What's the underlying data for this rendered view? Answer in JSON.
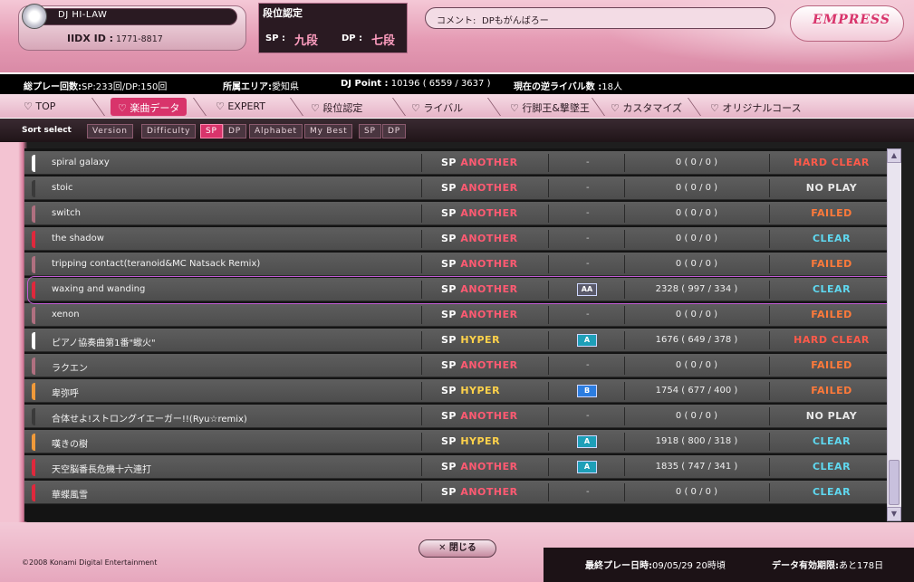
{
  "header": {
    "dj_name": "DJ HI-LAW",
    "iidx_id_label": "IIDX ID :",
    "iidx_id": "1771-8817",
    "dan_title": "段位認定",
    "sp_label": "SP :",
    "sp_dan": "九段",
    "dp_label": "DP :",
    "dp_dan": "七段",
    "comment_label": "コメント:",
    "comment_text": "DPもがんばろー",
    "logo_text": "EMPRESS"
  },
  "stats": {
    "plays_label": "総プレー回数:",
    "plays_value": "SP:233回/DP:150回",
    "area_label": "所属エリア:",
    "area_value": "愛知県",
    "djpoint_label": "DJ Point :",
    "djpoint_value": "10196 ( 6559 / 3637 )",
    "rival_label": "現在の逆ライバル数 :",
    "rival_value": "18人"
  },
  "nav": {
    "tabs": [
      {
        "label": "♡ TOP"
      },
      {
        "label": "♡ 楽曲データ"
      },
      {
        "label": "♡ EXPERT"
      },
      {
        "label": "♡ 段位認定"
      },
      {
        "label": "♡ ライバル"
      },
      {
        "label": "♡ 行脚王&撃墜王"
      },
      {
        "label": "♡ カスタマイズ"
      },
      {
        "label": "♡ オリジナルコース"
      }
    ]
  },
  "sort": {
    "label": "Sort select",
    "buttons": [
      "Version",
      "Difficulty",
      "SP",
      "DP",
      "Alphabet",
      "My Best",
      "SP",
      "DP"
    ]
  },
  "songs": [
    {
      "title": "spiral galaxy",
      "sp": "SP",
      "diff": "ANOTHER",
      "grade": "-",
      "score": "0 ( 0 / 0 )",
      "status": "HARD CLEAR",
      "accent": "#ffffff"
    },
    {
      "title": "stoic",
      "sp": "SP",
      "diff": "ANOTHER",
      "grade": "-",
      "score": "0 ( 0 / 0 )",
      "status": "NO PLAY",
      "accent": "#3a3a3a"
    },
    {
      "title": "switch",
      "sp": "SP",
      "diff": "ANOTHER",
      "grade": "-",
      "score": "0 ( 0 / 0 )",
      "status": "FAILED",
      "accent": "#b07080"
    },
    {
      "title": "the shadow",
      "sp": "SP",
      "diff": "ANOTHER",
      "grade": "-",
      "score": "0 ( 0 / 0 )",
      "status": "CLEAR",
      "accent": "#e0283c"
    },
    {
      "title": "tripping contact(teranoid&MC Natsack Remix)",
      "sp": "SP",
      "diff": "ANOTHER",
      "grade": "-",
      "score": "0 ( 0 / 0 )",
      "status": "FAILED",
      "accent": "#b07080"
    },
    {
      "title": "waxing and wanding",
      "sp": "SP",
      "diff": "ANOTHER",
      "grade": "AA",
      "score": "2328 ( 997 / 334 )",
      "status": "CLEAR",
      "accent": "#e0283c"
    },
    {
      "title": "xenon",
      "sp": "SP",
      "diff": "ANOTHER",
      "grade": "-",
      "score": "0 ( 0 / 0 )",
      "status": "FAILED",
      "accent": "#b07080"
    },
    {
      "title": "ピアノ協奏曲第1番\"蠍火\"",
      "sp": "SP",
      "diff": "HYPER",
      "grade": "A",
      "score": "1676 ( 649 / 378 )",
      "status": "HARD CLEAR",
      "accent": "#ffffff"
    },
    {
      "title": "ラクエン",
      "sp": "SP",
      "diff": "ANOTHER",
      "grade": "-",
      "score": "0 ( 0 / 0 )",
      "status": "FAILED",
      "accent": "#b07080"
    },
    {
      "title": "卑弥呼",
      "sp": "SP",
      "diff": "HYPER",
      "grade": "B",
      "score": "1754 ( 677 / 400 )",
      "status": "FAILED",
      "accent": "#f09a3a"
    },
    {
      "title": "合体せよ!ストロングイエーガー!!(Ryu☆remix)",
      "sp": "SP",
      "diff": "ANOTHER",
      "grade": "-",
      "score": "0 ( 0 / 0 )",
      "status": "NO PLAY",
      "accent": "#3a3a3a"
    },
    {
      "title": "嘆きの樹",
      "sp": "SP",
      "diff": "HYPER",
      "grade": "A",
      "score": "1918 ( 800 / 318 )",
      "status": "CLEAR",
      "accent": "#f09a3a"
    },
    {
      "title": "天空脳番長危機十六連打",
      "sp": "SP",
      "diff": "ANOTHER",
      "grade": "A",
      "score": "1835 ( 747 / 341 )",
      "status": "CLEAR",
      "accent": "#e0283c"
    },
    {
      "title": "華蝶風雪",
      "sp": "SP",
      "diff": "ANOTHER",
      "grade": "-",
      "score": "0 ( 0 / 0 )",
      "status": "CLEAR",
      "accent": "#e0283c"
    }
  ],
  "status_colors": {
    "HARD CLEAR": "#ff5a4a",
    "NO PLAY": "#e8e8e8",
    "FAILED": "#ff7a3a",
    "CLEAR": "#5fd8f0"
  },
  "footer": {
    "copyright": "©2008 Konami Digital Entertainment",
    "close_label": "✕ 閉じる",
    "last_play_label": "最終プレー日時:",
    "last_play_value": "09/05/29 20時頃",
    "valid_label": "データ有効期限:",
    "valid_value": "あと178日"
  }
}
